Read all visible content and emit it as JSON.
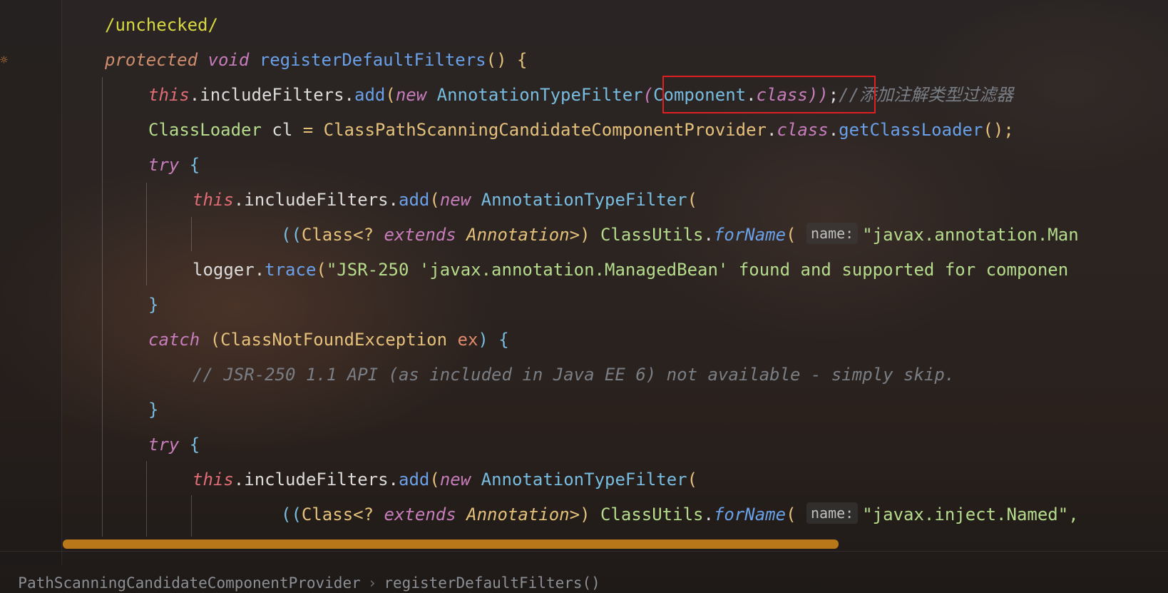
{
  "editor": {
    "lines": [
      {
        "id": "l0",
        "tokens": [
          {
            "t": "/unchecked/",
            "c": "ann"
          }
        ]
      },
      {
        "id": "l1",
        "tokens": [
          {
            "t": "protected",
            "c": "kw2"
          },
          {
            "t": " ",
            "c": "plain"
          },
          {
            "t": "void",
            "c": "kw"
          },
          {
            "t": " ",
            "c": "plain"
          },
          {
            "t": "registerDefaultFilters",
            "c": "fn"
          },
          {
            "t": "() {",
            "c": "cls"
          }
        ]
      },
      {
        "id": "l2",
        "tokens": [
          {
            "t": "this",
            "c": "this"
          },
          {
            "t": ".",
            "c": "plain"
          },
          {
            "t": "includeFilters",
            "c": "plain"
          },
          {
            "t": ".",
            "c": "plain"
          },
          {
            "t": "add",
            "c": "fn"
          },
          {
            "t": "(",
            "c": "cls"
          },
          {
            "t": "new",
            "c": "kw"
          },
          {
            "t": " ",
            "c": "plain"
          },
          {
            "t": "AnnotationTypeFilter",
            "c": "type"
          },
          {
            "t": "(",
            "c": "kw"
          },
          {
            "t": "Component",
            "c": "type"
          },
          {
            "t": ".",
            "c": "plain"
          },
          {
            "t": "class",
            "c": "kw"
          },
          {
            "t": "))",
            "c": "kw"
          },
          {
            "t": ";",
            "c": "plain"
          },
          {
            "t": "//添加注解类型过滤器",
            "c": "cm"
          }
        ]
      },
      {
        "id": "l3",
        "tokens": [
          {
            "t": "ClassLoader",
            "c": "str"
          },
          {
            "t": " cl ",
            "c": "plain"
          },
          {
            "t": "=",
            "c": "cls"
          },
          {
            "t": " ",
            "c": "plain"
          },
          {
            "t": "ClassPathScanningCandidateComponentProvider",
            "c": "cls"
          },
          {
            "t": ".",
            "c": "plain"
          },
          {
            "t": "class",
            "c": "kw"
          },
          {
            "t": ".",
            "c": "plain"
          },
          {
            "t": "getClassLoader",
            "c": "fn"
          },
          {
            "t": "();",
            "c": "cls"
          }
        ]
      },
      {
        "id": "l4",
        "tokens": [
          {
            "t": "try",
            "c": "kw"
          },
          {
            "t": " {",
            "c": "type"
          }
        ]
      },
      {
        "id": "l5",
        "tokens": [
          {
            "t": "this",
            "c": "this"
          },
          {
            "t": ".",
            "c": "plain"
          },
          {
            "t": "includeFilters",
            "c": "plain"
          },
          {
            "t": ".",
            "c": "plain"
          },
          {
            "t": "add",
            "c": "fn"
          },
          {
            "t": "(",
            "c": "cls"
          },
          {
            "t": "new",
            "c": "kw"
          },
          {
            "t": " ",
            "c": "plain"
          },
          {
            "t": "AnnotationTypeFilter",
            "c": "type"
          },
          {
            "t": "(",
            "c": "cls"
          }
        ]
      },
      {
        "id": "l6",
        "tokens": [
          {
            "t": "((",
            "c": "type"
          },
          {
            "t": "Class",
            "c": "cls"
          },
          {
            "t": "<? ",
            "c": "cls"
          },
          {
            "t": "extends",
            "c": "kw"
          },
          {
            "t": " ",
            "c": "plain"
          },
          {
            "t": "Annotation",
            "c": "cls ital"
          },
          {
            "t": ">) ",
            "c": "cls"
          },
          {
            "t": "ClassUtils",
            "c": "str"
          },
          {
            "t": ".",
            "c": "plain"
          },
          {
            "t": "forName",
            "c": "fn ital"
          },
          {
            "t": "( ",
            "c": "cls"
          },
          {
            "t": "name:",
            "c": "hint"
          },
          {
            "t": "\"javax.annotation.Man",
            "c": "str"
          }
        ]
      },
      {
        "id": "l7",
        "tokens": [
          {
            "t": "logger",
            "c": "plain"
          },
          {
            "t": ".",
            "c": "plain"
          },
          {
            "t": "trace",
            "c": "fn"
          },
          {
            "t": "(",
            "c": "cls"
          },
          {
            "t": "\"JSR-250 'javax.annotation.ManagedBean' found and supported for componen",
            "c": "str"
          }
        ]
      },
      {
        "id": "l8",
        "tokens": [
          {
            "t": "}",
            "c": "type"
          }
        ]
      },
      {
        "id": "l9",
        "tokens": [
          {
            "t": "catch",
            "c": "kw"
          },
          {
            "t": " (",
            "c": "cls"
          },
          {
            "t": "ClassNotFoundException",
            "c": "cls"
          },
          {
            "t": " ",
            "c": "plain"
          },
          {
            "t": "ex",
            "c": "param"
          },
          {
            "t": ") {",
            "c": "type"
          }
        ]
      },
      {
        "id": "l10",
        "tokens": [
          {
            "t": "// JSR-250 1.1 API (as included in Java EE 6) not available - simply skip.",
            "c": "cm"
          }
        ]
      },
      {
        "id": "l11",
        "tokens": [
          {
            "t": "}",
            "c": "type"
          }
        ]
      },
      {
        "id": "l12",
        "tokens": [
          {
            "t": "try",
            "c": "kw"
          },
          {
            "t": " {",
            "c": "type"
          }
        ]
      },
      {
        "id": "l13",
        "tokens": [
          {
            "t": "this",
            "c": "this"
          },
          {
            "t": ".",
            "c": "plain"
          },
          {
            "t": "includeFilters",
            "c": "plain"
          },
          {
            "t": ".",
            "c": "plain"
          },
          {
            "t": "add",
            "c": "fn"
          },
          {
            "t": "(",
            "c": "cls"
          },
          {
            "t": "new",
            "c": "kw"
          },
          {
            "t": " ",
            "c": "plain"
          },
          {
            "t": "AnnotationTypeFilter",
            "c": "type"
          },
          {
            "t": "(",
            "c": "cls"
          }
        ]
      },
      {
        "id": "l14",
        "tokens": [
          {
            "t": "((",
            "c": "type"
          },
          {
            "t": "Class",
            "c": "cls"
          },
          {
            "t": "<? ",
            "c": "cls"
          },
          {
            "t": "extends",
            "c": "kw"
          },
          {
            "t": " ",
            "c": "plain"
          },
          {
            "t": "Annotation",
            "c": "cls ital"
          },
          {
            "t": ">) ",
            "c": "cls"
          },
          {
            "t": "ClassUtils",
            "c": "str"
          },
          {
            "t": ".",
            "c": "plain"
          },
          {
            "t": "forName",
            "c": "fn ital"
          },
          {
            "t": "( ",
            "c": "cls"
          },
          {
            "t": "name:",
            "c": "hint"
          },
          {
            "t": "\"javax.inject.Named\",",
            "c": "str"
          }
        ]
      }
    ]
  },
  "breadcrumb": {
    "class_name": "PathScanningCandidateComponentProvider",
    "separator": "›",
    "method_name": "registerDefaultFilters()"
  },
  "colors": {
    "highlight_box": "#e02020",
    "scrollbar_thumb": "#b8781a"
  },
  "icons": {
    "gutter_icon": "bulb-icon"
  }
}
